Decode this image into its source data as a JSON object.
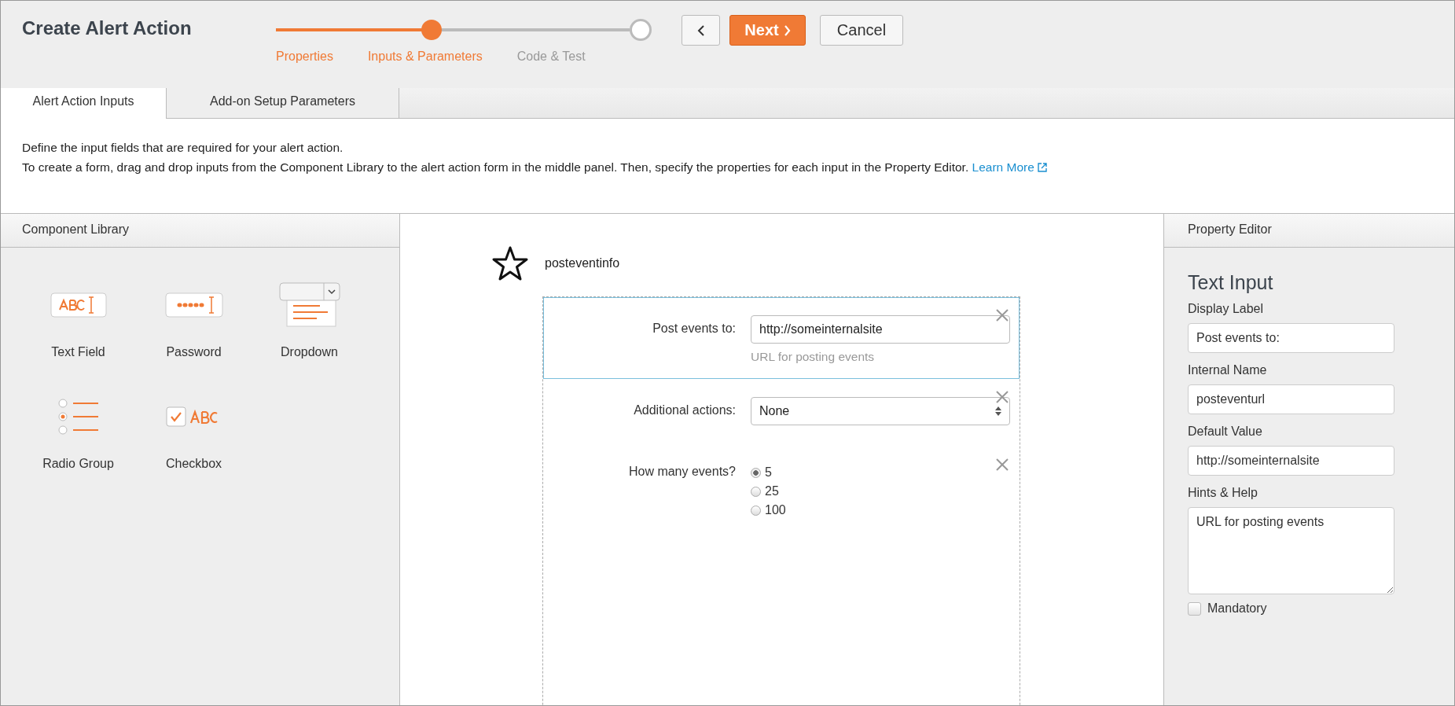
{
  "window": {
    "title": "Create Alert Action"
  },
  "progress": {
    "level": 0.44
  },
  "steps": [
    {
      "label": "Properties",
      "reached": true
    },
    {
      "label": "Inputs & Parameters",
      "reached": true
    },
    {
      "label": "Code & Test",
      "reached": false
    }
  ],
  "buttons": {
    "next": "Next",
    "cancel": "Cancel"
  },
  "tabs": [
    {
      "label": "Alert Action Inputs",
      "selected": true
    },
    {
      "label": "Add-on Setup Parameters",
      "selected": false
    }
  ],
  "description": {
    "lines": [
      "Define the input fields that are required for your alert action.",
      "To create a form, drag and drop inputs from the Component Library to the alert action form in the middle panel. Then, specify the properties for each input in the Property Editor."
    ],
    "link": "Learn More"
  },
  "component_library": {
    "title": "Component Library",
    "items": [
      {
        "kind": "text",
        "label": "Text Field"
      },
      {
        "kind": "password",
        "label": "Password"
      },
      {
        "kind": "dropdown",
        "label": "Dropdown"
      },
      {
        "kind": "radio",
        "label": "Radio Group"
      },
      {
        "kind": "checkbox",
        "label": "Checkbox"
      }
    ]
  },
  "form": {
    "name": "posteventinfo",
    "fields": [
      {
        "kind": "text",
        "label": "Post events to:",
        "value": "http://someinternalsite",
        "hint": "URL for posting events",
        "selected": true
      },
      {
        "kind": "select",
        "label": "Additional actions:",
        "value": "None",
        "selected": false
      },
      {
        "kind": "radio",
        "label": "How many events?",
        "selected": false,
        "options": [
          {
            "label": "5",
            "selected": true
          },
          {
            "label": "25",
            "selected": false
          },
          {
            "label": "100",
            "selected": false
          }
        ]
      }
    ]
  },
  "property_editor": {
    "title": "Property Editor",
    "heading": "Text Input",
    "fields": [
      {
        "kind": "input",
        "label": "Display Label",
        "value": "Post events to:"
      },
      {
        "kind": "input",
        "label": "Internal Name",
        "value": "posteventurl"
      },
      {
        "kind": "input",
        "label": "Default Value",
        "value": "http://someinternalsite"
      },
      {
        "kind": "textarea",
        "label": "Hints & Help",
        "value": "URL for posting events"
      }
    ],
    "mandatory": {
      "label": "Mandatory",
      "checked": false
    }
  }
}
